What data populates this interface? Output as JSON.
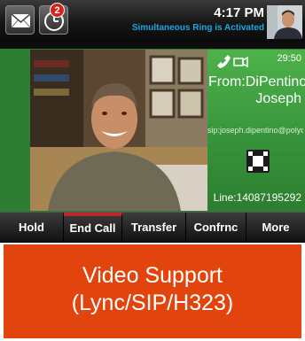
{
  "status_bar": {
    "mail_icon": "envelope-icon",
    "missed_calls_icon": "missed-calls-icon",
    "badge_count": "2",
    "time": "4:17 PM",
    "status_message": "Simultaneous Ring is Activated"
  },
  "call": {
    "duration": "29:50",
    "from_line1": "From:DiPentino,",
    "from_line2": "Joseph",
    "sip_address": "sip:joseph.dipentino@polyco...",
    "line": "Line:14087195292",
    "icons": [
      "handset-icon",
      "video-camera-icon",
      "fullscreen-icon"
    ]
  },
  "softkeys": [
    {
      "label": "Hold"
    },
    {
      "label": "End Call",
      "active": true
    },
    {
      "label": "Transfer"
    },
    {
      "label": "Confrnc"
    },
    {
      "label": "More"
    }
  ],
  "banner": {
    "line1": "Video Support",
    "line2": "(Lync/SIP/H323)"
  },
  "colors": {
    "call_green": "#3a9a3e",
    "banner_orange": "#e2440d",
    "accent_blue": "#19a8e0",
    "end_call_red": "#c0262d"
  }
}
